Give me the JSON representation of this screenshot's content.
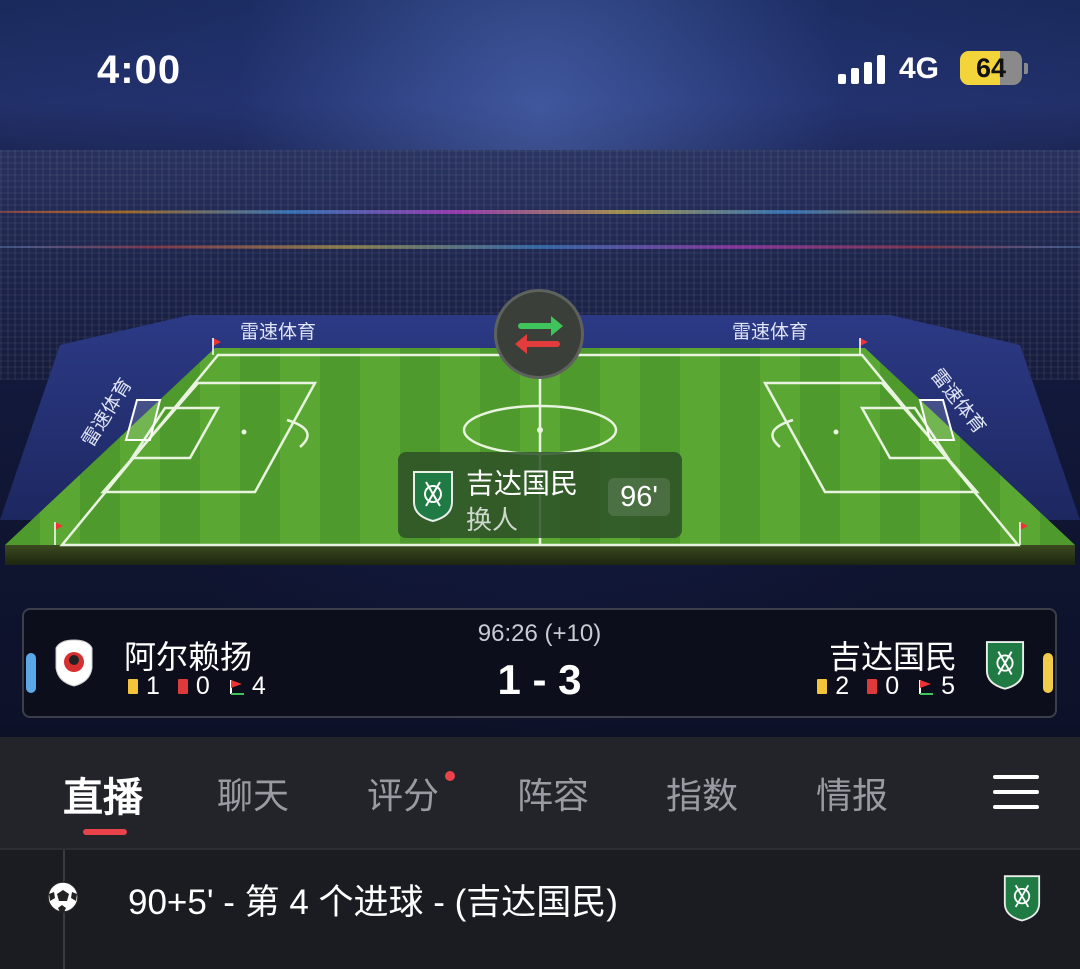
{
  "status_bar": {
    "time": "4:00",
    "network": "4G",
    "battery": "64",
    "battery_level": 0.64
  },
  "pitch": {
    "sponsor_boards": [
      "雷速体育",
      "雷速体育",
      "雷速体育",
      "雷速体育"
    ],
    "sub_icon": "substitution-arrows-icon"
  },
  "event_card": {
    "team": "吉达国民",
    "event": "换人",
    "minute": "96'"
  },
  "match": {
    "time": "96:26 (+10)",
    "score": "1 - 3",
    "home": {
      "name": "阿尔赖扬",
      "yellow": "1",
      "red": "0",
      "corners": "4",
      "color": "#5aa9e6"
    },
    "away": {
      "name": "吉达国民",
      "yellow": "2",
      "red": "0",
      "corners": "5",
      "color": "#f1cc4a"
    }
  },
  "tabs": [
    {
      "label": "直播",
      "active": true
    },
    {
      "label": "聊天"
    },
    {
      "label": "评分",
      "badge": true
    },
    {
      "label": "阵容"
    },
    {
      "label": "指数"
    },
    {
      "label": "情报"
    }
  ],
  "feed": [
    {
      "icon": "soccer-ball-icon",
      "text": "90+5' - 第 4 个进球 - (吉达国民)"
    }
  ]
}
